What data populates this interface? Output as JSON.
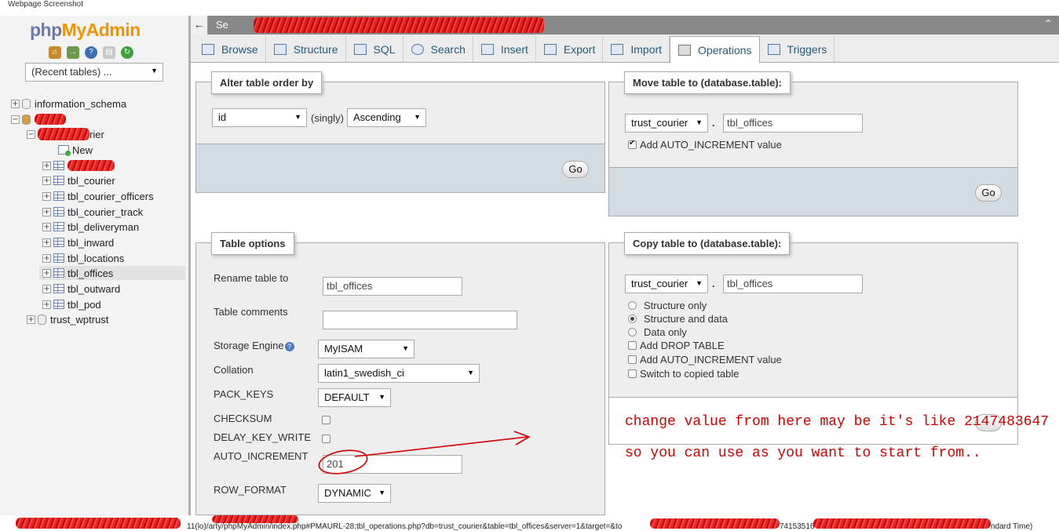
{
  "caption": "Webpage Screenshot",
  "sidebar": {
    "logo_php": "php",
    "logo_myadmin": "MyAdmin",
    "recent_tables": "(Recent tables) ...",
    "databases": {
      "information_schema": "information_schema",
      "expanded_db_suffix": "rier",
      "new_label": "New",
      "tables": [
        "tbl_courier",
        "tbl_courier_officers",
        "tbl_courier_track",
        "tbl_deliveryman",
        "tbl_inward",
        "tbl_locations",
        "tbl_offices",
        "tbl_outward",
        "tbl_pod"
      ],
      "last_db": "trust_wptrust"
    }
  },
  "topbar": {
    "crumb": "Se",
    "collapse": "⌃"
  },
  "tabs": [
    "Browse",
    "Structure",
    "SQL",
    "Search",
    "Insert",
    "Export",
    "Import",
    "Operations",
    "Triggers"
  ],
  "alter_order": {
    "legend": "Alter table order by",
    "column": "id",
    "singly": "(singly)",
    "direction": "Ascending",
    "go": "Go"
  },
  "move_table": {
    "legend": "Move table to (database.table):",
    "database": "trust_courier",
    "dot": ".",
    "table": "tbl_offices",
    "auto_inc_label": "Add AUTO_INCREMENT value",
    "go": "Go"
  },
  "table_options": {
    "legend": "Table options",
    "rename_label": "Rename table to",
    "rename_value": "tbl_offices",
    "comments_label": "Table comments",
    "comments_value": "",
    "engine_label": "Storage Engine",
    "engine_value": "MyISAM",
    "collation_label": "Collation",
    "collation_value": "latin1_swedish_ci",
    "pack_keys_label": "PACK_KEYS",
    "pack_keys_value": "DEFAULT",
    "checksum_label": "CHECKSUM",
    "delay_key_write_label": "DELAY_KEY_WRITE",
    "auto_increment_label": "AUTO_INCREMENT",
    "auto_increment_value": "201",
    "row_format_label": "ROW_FORMAT",
    "row_format_value": "DYNAMIC"
  },
  "copy_table": {
    "legend": "Copy table to (database.table):",
    "database": "trust_courier",
    "dot": ".",
    "table": "tbl_offices",
    "structure_only": "Structure only",
    "structure_and_data": "Structure and data",
    "data_only": "Data only",
    "add_drop_table": "Add DROP TABLE",
    "add_auto_increment": "Add AUTO_INCREMENT value",
    "switch_to_copied": "Switch to copied table"
  },
  "annotation": {
    "line1": "change value from here may be it's like 2147483647",
    "line2": "so you can use as you want to start from.."
  },
  "statusbar": {
    "url": "11(lo)/arty/phpMyAdmin/index.php#PMAURL-28:tbl_operations.php?db=trust_courier&table=tbl_offices&server=1&target=&to",
    "mid": "74153516",
    "tail": "ndard Time)"
  },
  "colors": {
    "annotation": "#d40000",
    "tab_text": "#235a81",
    "logo_php": "#6c78af",
    "logo_myadmin": "#f29400"
  }
}
